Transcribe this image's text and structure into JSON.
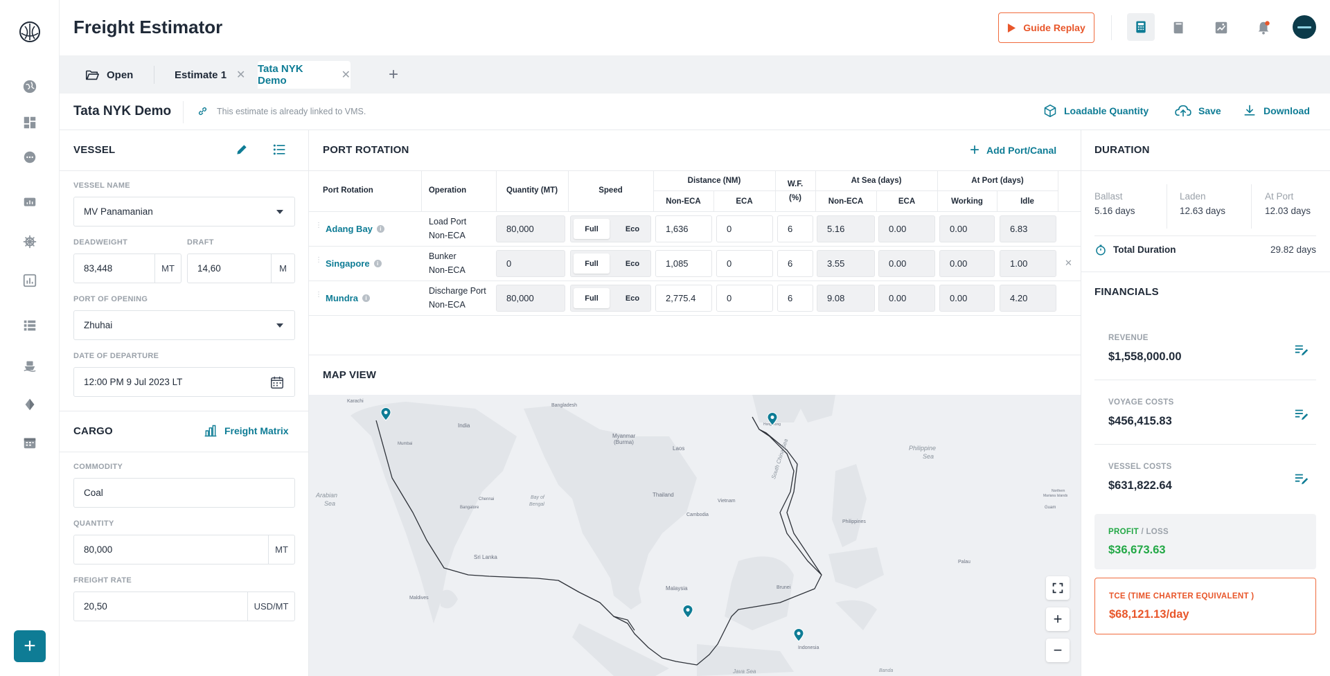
{
  "app": {
    "title": "Freight Estimator",
    "guide_replay_label": "Guide Replay"
  },
  "tabs": {
    "open_label": "Open",
    "items": [
      {
        "label": "Estimate 1"
      },
      {
        "label": "Tata NYK Demo"
      }
    ],
    "add_label": "+"
  },
  "estimate": {
    "title": "Tata NYK Demo",
    "vms_note": "This estimate is already linked to VMS.",
    "loadable_quantity_label": "Loadable Quantity",
    "save_label": "Save",
    "download_label": "Download"
  },
  "vessel": {
    "section_title": "VESSEL",
    "name_label": "VESSEL NAME",
    "name_value": "MV Panamanian",
    "deadweight_label": "DEADWEIGHT",
    "deadweight_value": "83,448",
    "deadweight_unit": "MT",
    "draft_label": "DRAFT",
    "draft_value": "14,60",
    "draft_unit": "M",
    "port_label": "PORT OF OPENING",
    "port_value": "Zhuhai",
    "departure_label": "DATE OF DEPARTURE",
    "departure_value": "12:00 PM 9 Jul 2023 LT"
  },
  "cargo": {
    "section_title": "CARGO",
    "freight_matrix_label": "Freight Matrix",
    "commodity_label": "COMMODITY",
    "commodity_value": "Coal",
    "quantity_label": "QUANTITY",
    "quantity_value": "80,000",
    "quantity_unit": "MT",
    "rate_label": "FREIGHT RATE",
    "rate_value": "20,50",
    "rate_unit": "USD/MT"
  },
  "rotation": {
    "section_title": "PORT ROTATION",
    "add_label": "Add Port/Canal",
    "headers": {
      "port": "Port Rotation",
      "operation": "Operation",
      "quantity": "Quantity (MT)",
      "speed": "Speed",
      "distance": "Distance (NM)",
      "non_eca": "Non-ECA",
      "eca": "ECA",
      "wf_line1": "W.F.",
      "wf_line2": "(%)",
      "at_sea": "At Sea (days)",
      "at_port": "At Port (days)",
      "working": "Working",
      "idle": "Idle"
    },
    "full_label": "Full",
    "eco_label": "Eco",
    "rows": [
      {
        "port": "Adang Bay",
        "op1": "Load Port",
        "op2": "Non-ECA",
        "qty": "80,000",
        "dist_neca": "1,636",
        "dist_eca": "0",
        "wf": "6",
        "sea_neca": "5.16",
        "sea_eca": "0.00",
        "working": "0.00",
        "idle": "6.83"
      },
      {
        "port": "Singapore",
        "op1": "Bunker",
        "op2": "Non-ECA",
        "qty": "0",
        "dist_neca": "1,085",
        "dist_eca": "0",
        "wf": "6",
        "sea_neca": "3.55",
        "sea_eca": "0.00",
        "working": "0.00",
        "idle": "1.00"
      },
      {
        "port": "Mundra",
        "op1": "Discharge Port",
        "op2": "Non-ECA",
        "qty": "80,000",
        "dist_neca": "2,775.4",
        "dist_eca": "0",
        "wf": "6",
        "sea_neca": "9.08",
        "sea_eca": "0.00",
        "working": "0.00",
        "idle": "4.20"
      }
    ]
  },
  "map": {
    "section_title": "MAP VIEW",
    "labels": [
      "Karachi",
      "Bangladesh",
      "Myanmar",
      "(Burma)",
      "India",
      "Mumbai",
      "Laos",
      "Bay of",
      "Bengal",
      "Thailand",
      "Vietnam",
      "Cambodia",
      "Arabian",
      "Sea",
      "Philippine",
      "Sea",
      "South China Sea",
      "Philippines",
      "Sri Lanka",
      "Malaysia",
      "Brunei",
      "Maldives",
      "Indonesia",
      "Java Sea",
      "Bangalore",
      "Chennai",
      "Hong Kong",
      "Palau",
      "Guam",
      "Northern",
      "Mariana Islands",
      "Banda"
    ]
  },
  "duration": {
    "section_title": "DURATION",
    "ballast_label": "Ballast",
    "ballast_value": "5.16 days",
    "laden_label": "Laden",
    "laden_value": "12.63 days",
    "port_label": "At Port",
    "port_value": "12.03 days",
    "total_label": "Total Duration",
    "total_value": "29.82 days"
  },
  "financials": {
    "section_title": "FINANCIALS",
    "revenue_label": "REVENUE",
    "revenue_value": "$1,558,000.00",
    "voyage_label": "VOYAGE COSTS",
    "voyage_value": "$456,415.83",
    "vessel_label": "VESSEL COSTS",
    "vessel_value": "$631,822.64",
    "profit_label": "PROFIT",
    "loss_label": "/ LOSS",
    "profit_value": "$36,673.63",
    "tce_label": "TCE (TIME CHARTER EQUIVALENT )",
    "tce_value": "$68,121.13/day"
  },
  "colors": {
    "accent": "#0e7c95",
    "orange": "#e8562a",
    "profit": "#22a845"
  }
}
